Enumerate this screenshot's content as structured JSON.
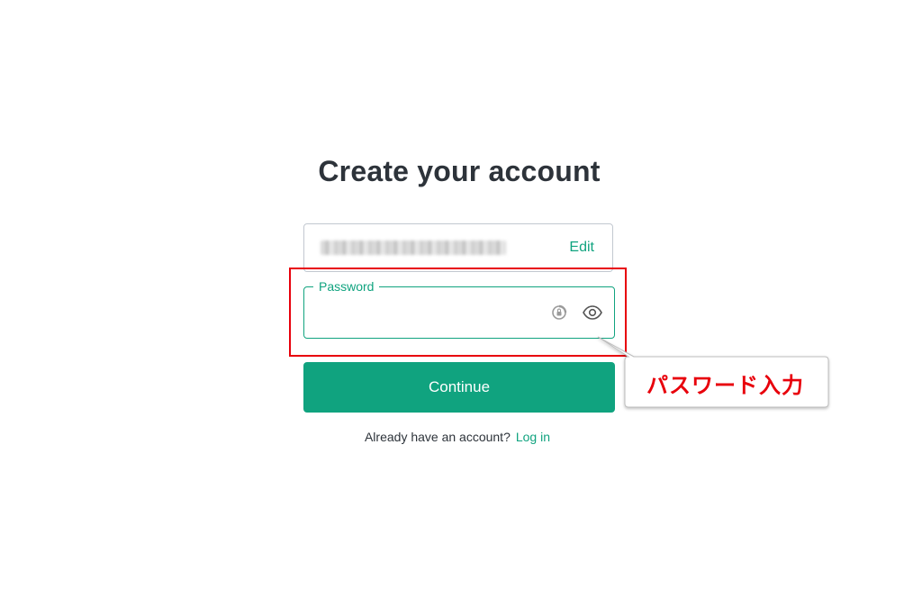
{
  "page": {
    "title": "Create your account"
  },
  "email": {
    "edit_label": "Edit"
  },
  "password": {
    "label": "Password",
    "value": ""
  },
  "continue_button": {
    "label": "Continue"
  },
  "login_prompt": {
    "text": "Already have an account?",
    "link_label": "Log in"
  },
  "annotation": {
    "text": "パスワード入力"
  },
  "colors": {
    "accent": "#10a37f",
    "annotation_red": "#e8000b",
    "title_text": "#2d333a"
  },
  "icons": {
    "password_manager": "password-manager-icon",
    "show_password": "eye-icon"
  }
}
